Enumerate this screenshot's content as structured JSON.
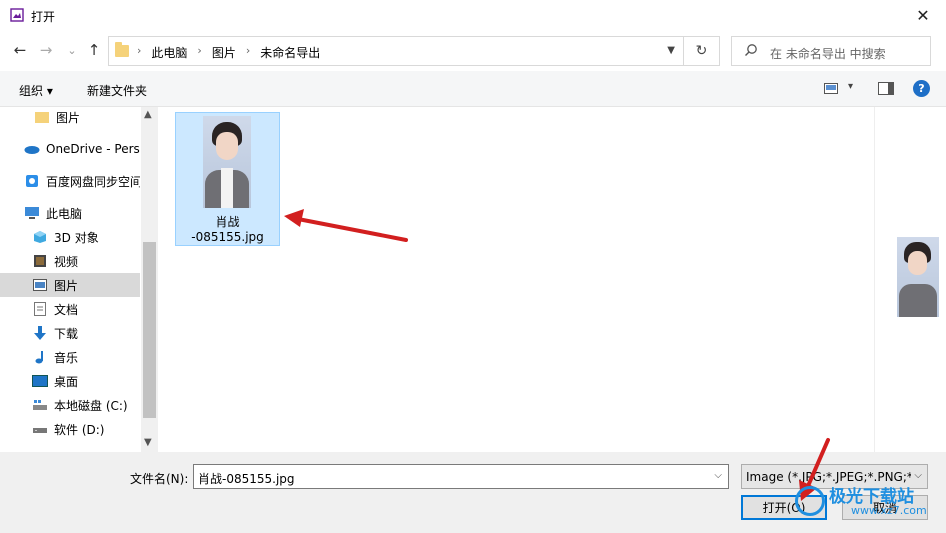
{
  "window": {
    "title": "打开",
    "close_glyph": "✕"
  },
  "nav": {
    "back_glyph": "←",
    "forward_glyph": "→",
    "recent_glyph": "⌄",
    "up_glyph": "↑",
    "breadcrumbs": [
      "此电脑",
      "图片",
      "未命名导出"
    ],
    "breadcrumb_sep": "›",
    "refresh_glyph": "↻",
    "search_placeholder": "在 未命名导出 中搜索"
  },
  "toolbar": {
    "organize_label": "组织 ▾",
    "new_folder_label": "新建文件夹",
    "view_glyph": "▾",
    "help_glyph": "?"
  },
  "sidebar": {
    "items": [
      {
        "label": "图片",
        "icon": "folder-icon",
        "indent": true
      },
      {
        "label": "OneDrive - Perso",
        "icon": "onedrive-icon",
        "indent": false
      },
      {
        "label": "百度网盘同步空间",
        "icon": "baidu-icon",
        "indent": false
      },
      {
        "label": "此电脑",
        "icon": "computer-icon",
        "indent": false
      },
      {
        "label": "3D 对象",
        "icon": "3d-objects-icon",
        "indent": true
      },
      {
        "label": "视频",
        "icon": "video-icon",
        "indent": true
      },
      {
        "label": "图片",
        "icon": "pictures-icon",
        "indent": true,
        "selected": true
      },
      {
        "label": "文档",
        "icon": "documents-icon",
        "indent": true
      },
      {
        "label": "下载",
        "icon": "download-icon",
        "indent": true
      },
      {
        "label": "音乐",
        "icon": "music-icon",
        "indent": true
      },
      {
        "label": "桌面",
        "icon": "desktop-icon",
        "indent": true
      },
      {
        "label": "本地磁盘 (C:)",
        "icon": "drive-c-icon",
        "indent": true
      },
      {
        "label": "软件 (D:)",
        "icon": "drive-d-icon",
        "indent": true
      }
    ]
  },
  "files": [
    {
      "name_line1": "肖战",
      "name_line2": "-085155.jpg"
    }
  ],
  "bottom": {
    "filename_label": "文件名(N):",
    "filename_value": "肖战-085155.jpg",
    "filetype_value": "Image (*.JPG;*.JPEG;*.PNG;*.B",
    "open_label": "打开(O)",
    "cancel_label": "取消"
  },
  "watermark": {
    "text": "极光下载站",
    "url": "www.xz7.com"
  },
  "colors": {
    "accent": "#0078d7",
    "selection": "#cce8ff",
    "arrow": "#d21f1f"
  }
}
